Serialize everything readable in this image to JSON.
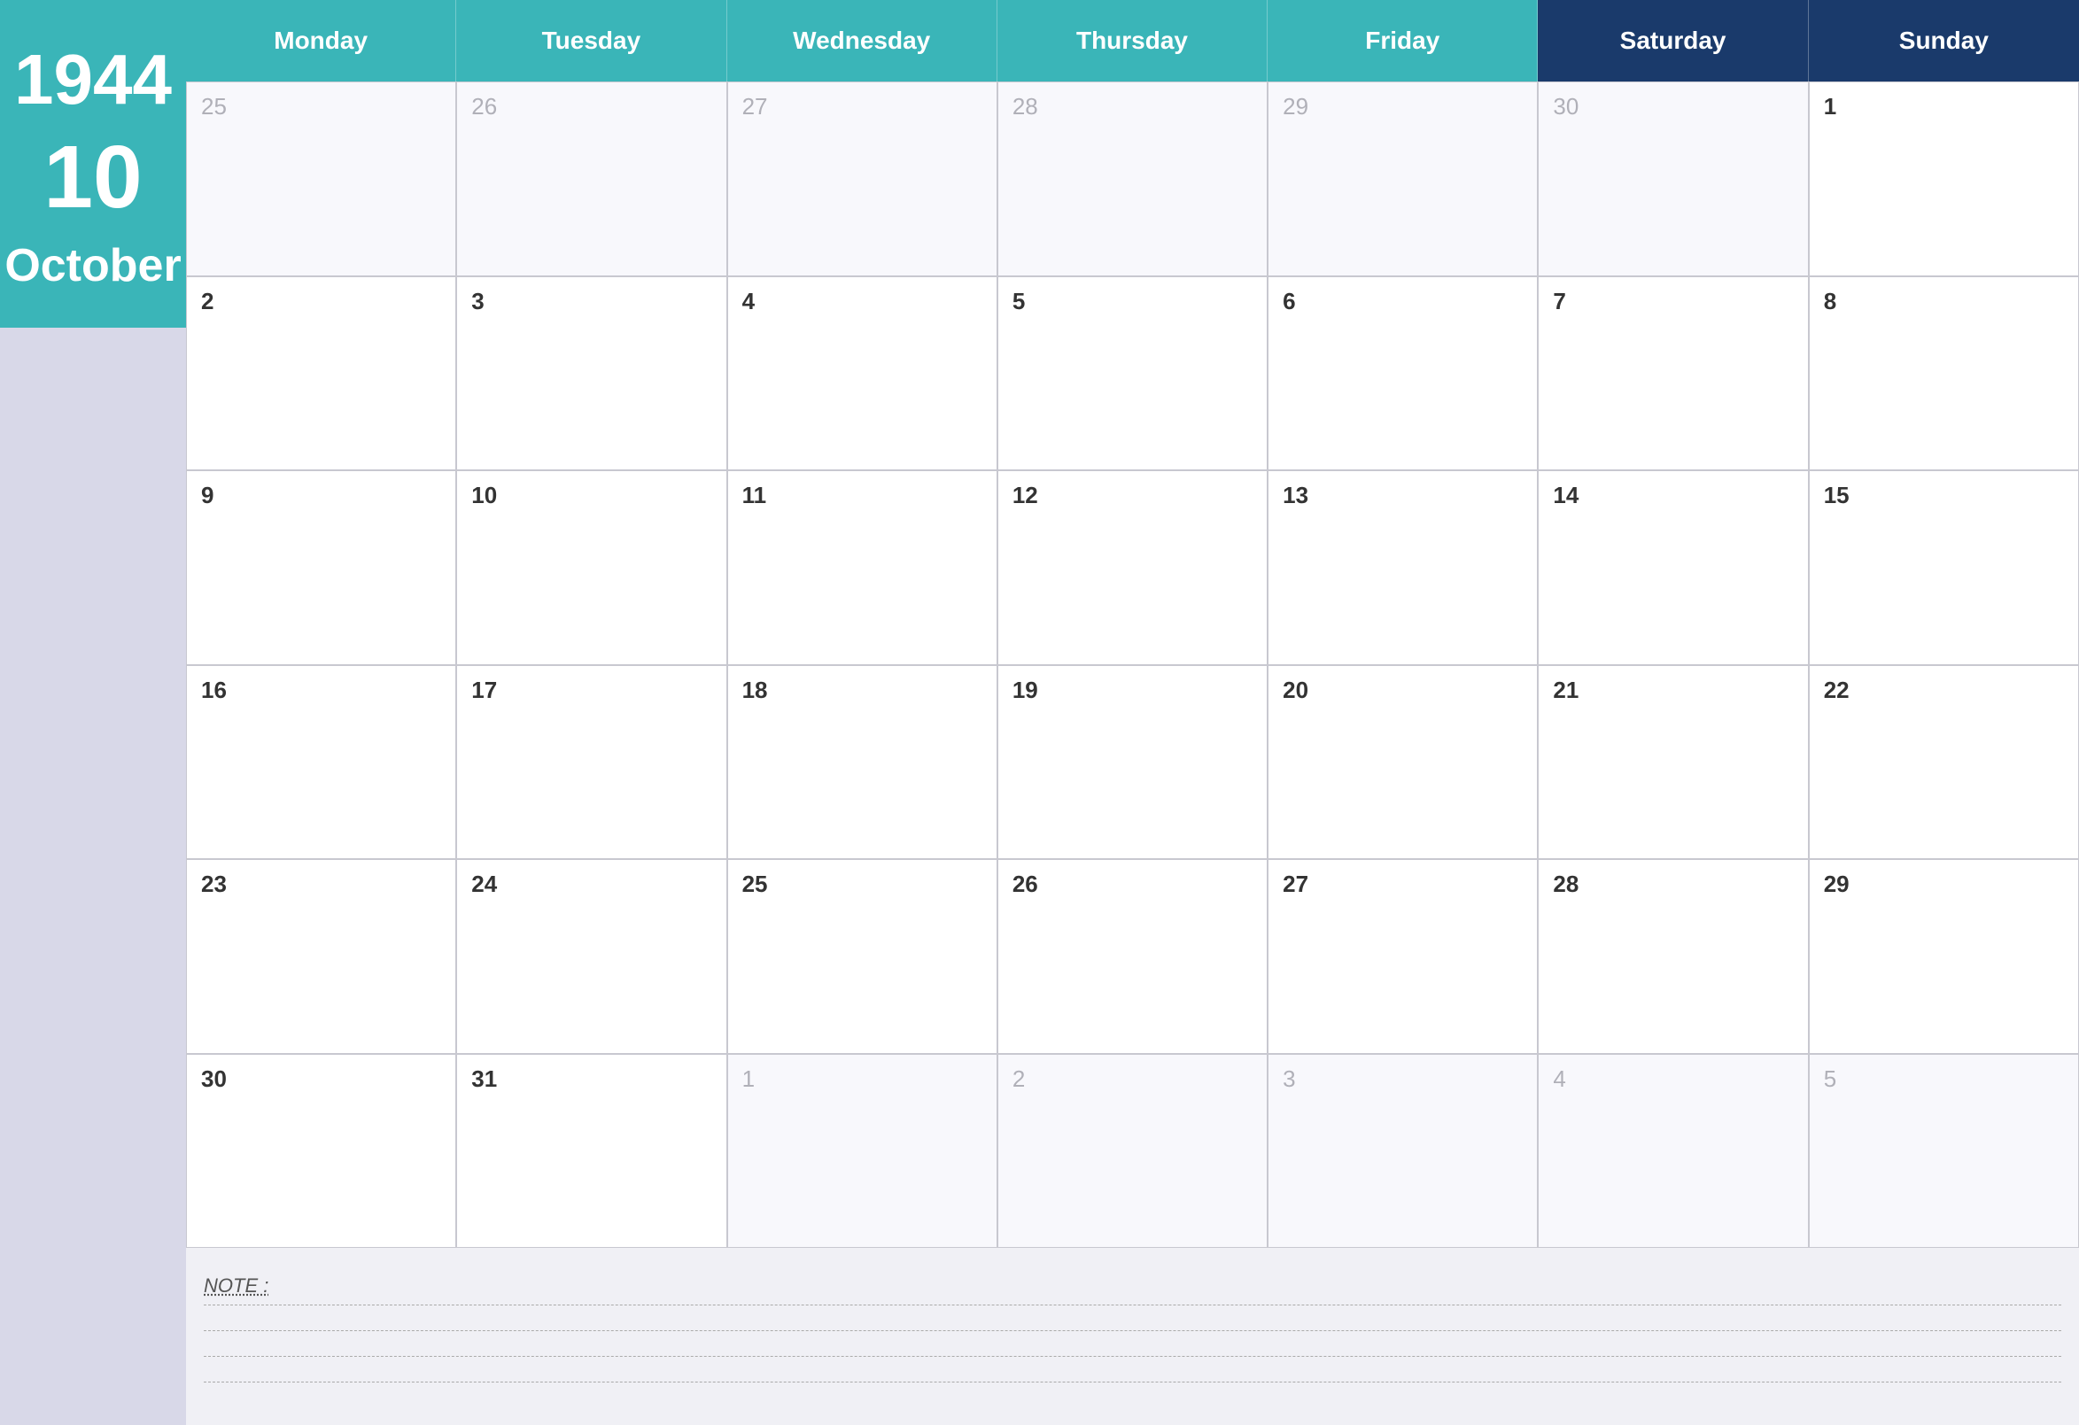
{
  "sidebar": {
    "year": "1944",
    "month_num": "10",
    "month_name": "October",
    "bg_color_top": "#3ab5b8",
    "bg_color_bottom": "#d8d8e8"
  },
  "header": {
    "days": [
      "Monday",
      "Tuesday",
      "Wednesday",
      "Thursday",
      "Friday",
      "Saturday",
      "Sunday"
    ],
    "accent_color": "#3ab5b8",
    "dark_color": "#1a3a6b"
  },
  "weeks": [
    {
      "days": [
        {
          "num": "25",
          "out": true
        },
        {
          "num": "26",
          "out": true
        },
        {
          "num": "27",
          "out": true
        },
        {
          "num": "28",
          "out": true
        },
        {
          "num": "29",
          "out": true
        },
        {
          "num": "30",
          "out": true
        },
        {
          "num": "1",
          "out": false
        }
      ]
    },
    {
      "days": [
        {
          "num": "2",
          "out": false
        },
        {
          "num": "3",
          "out": false
        },
        {
          "num": "4",
          "out": false
        },
        {
          "num": "5",
          "out": false
        },
        {
          "num": "6",
          "out": false
        },
        {
          "num": "7",
          "out": false
        },
        {
          "num": "8",
          "out": false
        }
      ]
    },
    {
      "days": [
        {
          "num": "9",
          "out": false
        },
        {
          "num": "10",
          "out": false
        },
        {
          "num": "11",
          "out": false
        },
        {
          "num": "12",
          "out": false
        },
        {
          "num": "13",
          "out": false
        },
        {
          "num": "14",
          "out": false
        },
        {
          "num": "15",
          "out": false
        }
      ]
    },
    {
      "days": [
        {
          "num": "16",
          "out": false
        },
        {
          "num": "17",
          "out": false
        },
        {
          "num": "18",
          "out": false
        },
        {
          "num": "19",
          "out": false
        },
        {
          "num": "20",
          "out": false
        },
        {
          "num": "21",
          "out": false
        },
        {
          "num": "22",
          "out": false
        }
      ]
    },
    {
      "days": [
        {
          "num": "23",
          "out": false
        },
        {
          "num": "24",
          "out": false
        },
        {
          "num": "25",
          "out": false
        },
        {
          "num": "26",
          "out": false
        },
        {
          "num": "27",
          "out": false
        },
        {
          "num": "28",
          "out": false
        },
        {
          "num": "29",
          "out": false
        }
      ]
    },
    {
      "days": [
        {
          "num": "30",
          "out": false
        },
        {
          "num": "31",
          "out": false
        },
        {
          "num": "1",
          "out": true
        },
        {
          "num": "2",
          "out": true
        },
        {
          "num": "3",
          "out": true
        },
        {
          "num": "4",
          "out": true
        },
        {
          "num": "5",
          "out": true
        }
      ]
    }
  ],
  "notes": {
    "label": "NOTE :",
    "lines": 4
  }
}
